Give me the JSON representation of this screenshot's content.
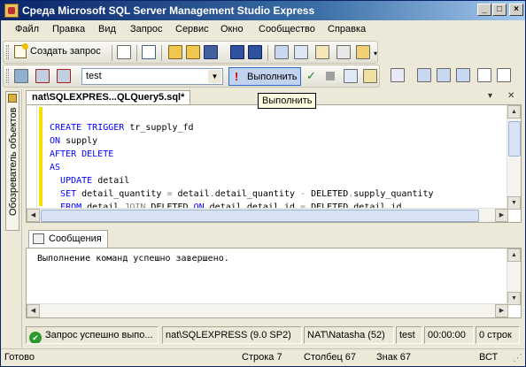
{
  "window": {
    "title": "Среда Microsoft SQL Server Management Studio Express"
  },
  "menu": [
    "Файл",
    "Правка",
    "Вид",
    "Запрос",
    "Сервис",
    "Окно",
    "Сообщество",
    "Справка"
  ],
  "toolbar": {
    "new_query_label": "Создать запрос",
    "database": "test",
    "execute_label": "Выполнить",
    "execute_tooltip": "Выполнить"
  },
  "leftdock": {
    "object_explorer_tab": "Обозреватель объектов"
  },
  "document": {
    "tab_title": "nat\\SQLEXPRES...QLQuery5.sql*"
  },
  "code_lines": [
    "CREATE TRIGGER tr_supply_fd",
    "ON supply",
    "AFTER DELETE",
    "AS",
    "  UPDATE detail",
    "  SET detail_quantity = detail.detail_quantity - DELETED.supply_quantity",
    "  FROM detail JOIN DELETED ON detail.detail_id = DELETED.detail_id"
  ],
  "results": {
    "tab_label": "Сообщения",
    "message": "Выполнение команд успешно завершено."
  },
  "query_status": {
    "status_text": "Запрос успешно выпо...",
    "server": "nat\\SQLEXPRESS (9.0 SP2)",
    "user": "NAT\\Natasha (52)",
    "database": "test",
    "elapsed": "00:00:00",
    "rows": "0 строк"
  },
  "statusbar": {
    "ready": "Готово",
    "line": "Строка 7",
    "column": "Столбец 67",
    "char": "Знак 67",
    "mode": "ВСТ"
  }
}
